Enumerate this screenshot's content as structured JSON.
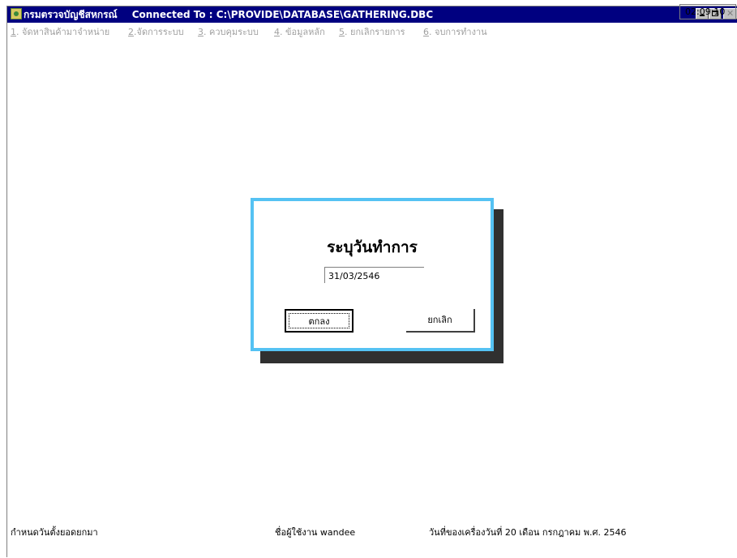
{
  "window": {
    "app_name": "กรมตรวจบัญชีสหกรณ์",
    "connection_text": "Connected  To  : C:\\PROVIDE\\DATABASE\\GATHERING.DBC"
  },
  "menu": {
    "items": [
      {
        "key": "1",
        "label": ". จัดหาสินค้ามาจำหน่าย"
      },
      {
        "key": "2",
        "label": ".จัดการระบบ"
      },
      {
        "key": "3",
        "label": ". ควบคุมระบบ"
      },
      {
        "key": "4",
        "label": ". ข้อมูลหลัก"
      },
      {
        "key": "5",
        "label": ". ยกเลิกรายการ"
      },
      {
        "key": "6",
        "label": ". จบการทำงาน"
      }
    ]
  },
  "dialog": {
    "title": "ระบุวันทำการ",
    "date_value": "31/03/2546",
    "ok_label": "ตกลง",
    "cancel_label": "ยกเลิก",
    "border_color": "#55c2f3"
  },
  "status": {
    "left_text": "กำหนดวันตั้งยอดยกมา",
    "user_text": "ชื่อผู้ใช้งาน wandee",
    "date_text": "วันที่ของเครื่องวันที่ 20 เดือน กรกฎาคม  พ.ศ. 2546",
    "time_text": "02:09:10"
  },
  "colors": {
    "titlebar": "#000080",
    "menu_disabled": "#a0a0a0"
  }
}
